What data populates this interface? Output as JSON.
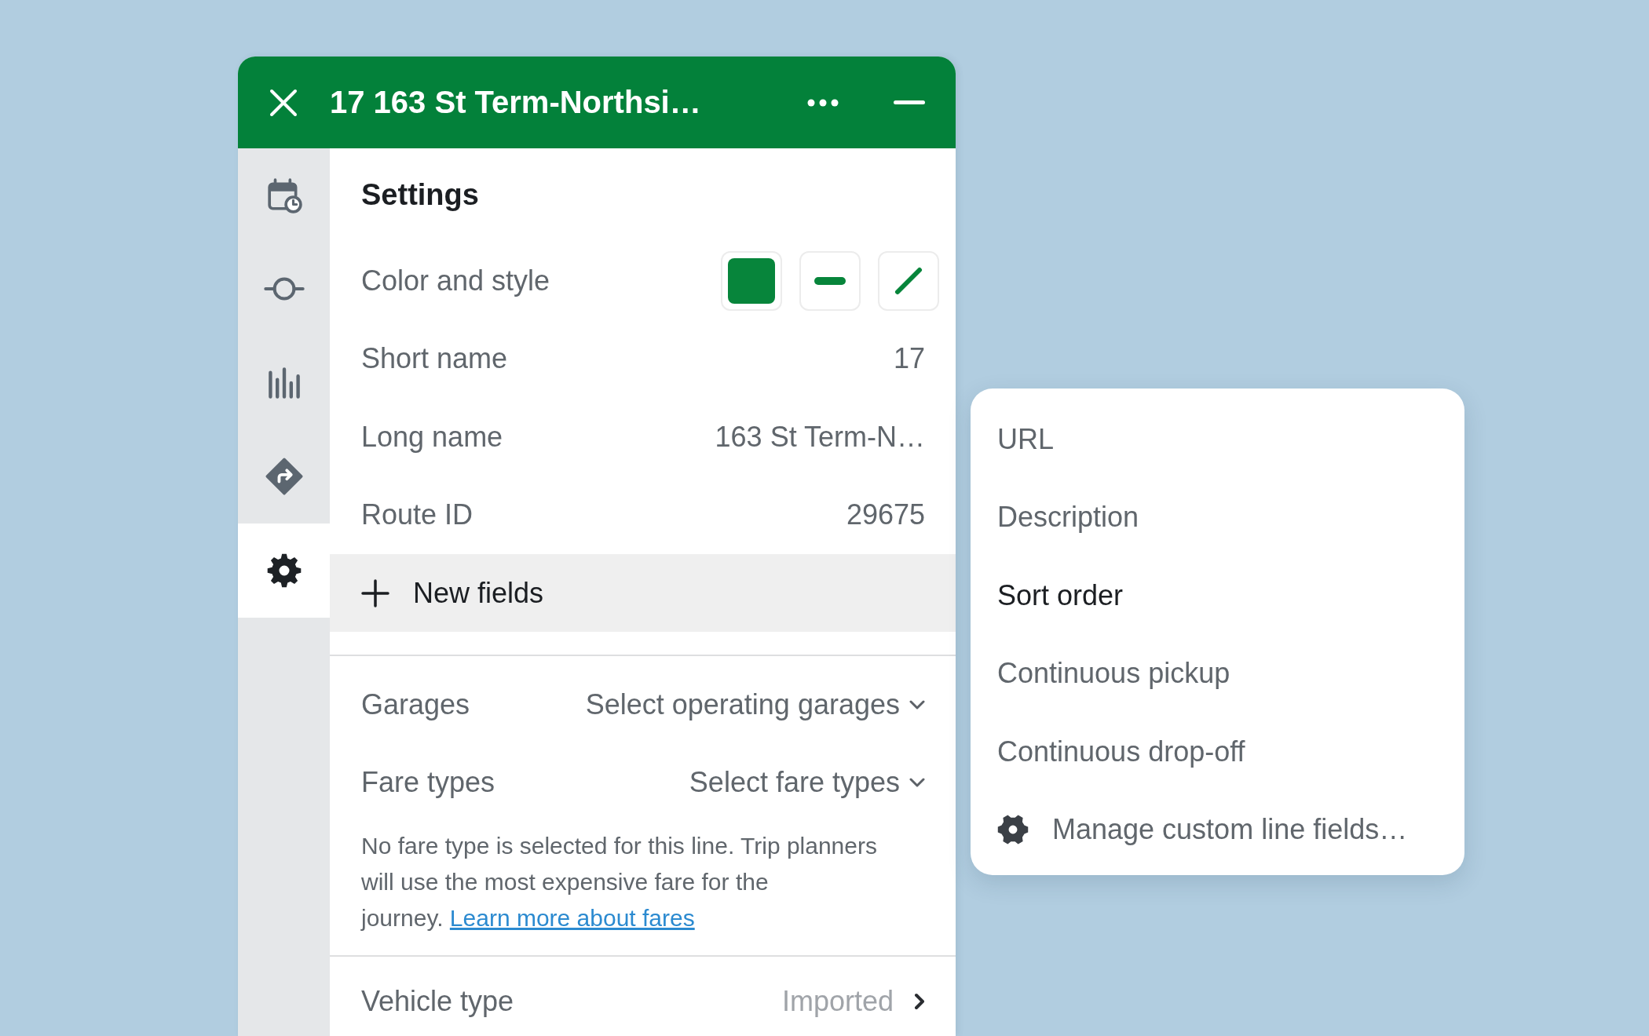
{
  "header": {
    "title": "17 163 St Term-Northsi…"
  },
  "sidebar": {
    "items": [
      {
        "kind": "calendar",
        "selected": false
      },
      {
        "kind": "target",
        "selected": false
      },
      {
        "kind": "chart",
        "selected": false
      },
      {
        "kind": "diamond",
        "selected": false
      },
      {
        "kind": "gear",
        "selected": true
      }
    ]
  },
  "settings": {
    "title": "Settings",
    "fields": [
      {
        "kind": "style",
        "label": "Color and style",
        "color": "#07853b",
        "dimmed": true
      },
      {
        "kind": "text",
        "label": "Short name",
        "value": "17",
        "dimmed": true
      },
      {
        "kind": "text",
        "label": "Long name",
        "value": "163 St Term-N…",
        "dimmed": true
      },
      {
        "kind": "text",
        "label": "Route ID",
        "value": "29675",
        "dimmed": true
      }
    ],
    "new_fields": {
      "label": "New fields"
    },
    "selectors": [
      {
        "label": "Garages",
        "placeholder": "Select operating garages",
        "dimmed": true
      },
      {
        "label": "Fare types",
        "placeholder": "Select fare types",
        "dimmed": true
      }
    ],
    "fare_note": {
      "text": "No fare type is selected for this line. Trip planners will use the most expensive fare for the journey.",
      "link": "Learn more about fares",
      "dimmed": true
    },
    "vehicle_type": {
      "label": "Vehicle type",
      "value": "Imported",
      "dimmed": true
    }
  },
  "menu": {
    "items": [
      {
        "kind": "field",
        "label": "URL",
        "dimmed": true
      },
      {
        "kind": "field",
        "label": "Description",
        "dimmed": true
      },
      {
        "kind": "field",
        "label": "Sort order",
        "dimmed": false
      },
      {
        "kind": "field",
        "label": "Continuous pickup",
        "dimmed": true
      },
      {
        "kind": "field",
        "label": "Continuous drop-off",
        "dimmed": true
      },
      {
        "kind": "action",
        "label": "Manage custom line fields…",
        "dimmed": true
      }
    ]
  }
}
